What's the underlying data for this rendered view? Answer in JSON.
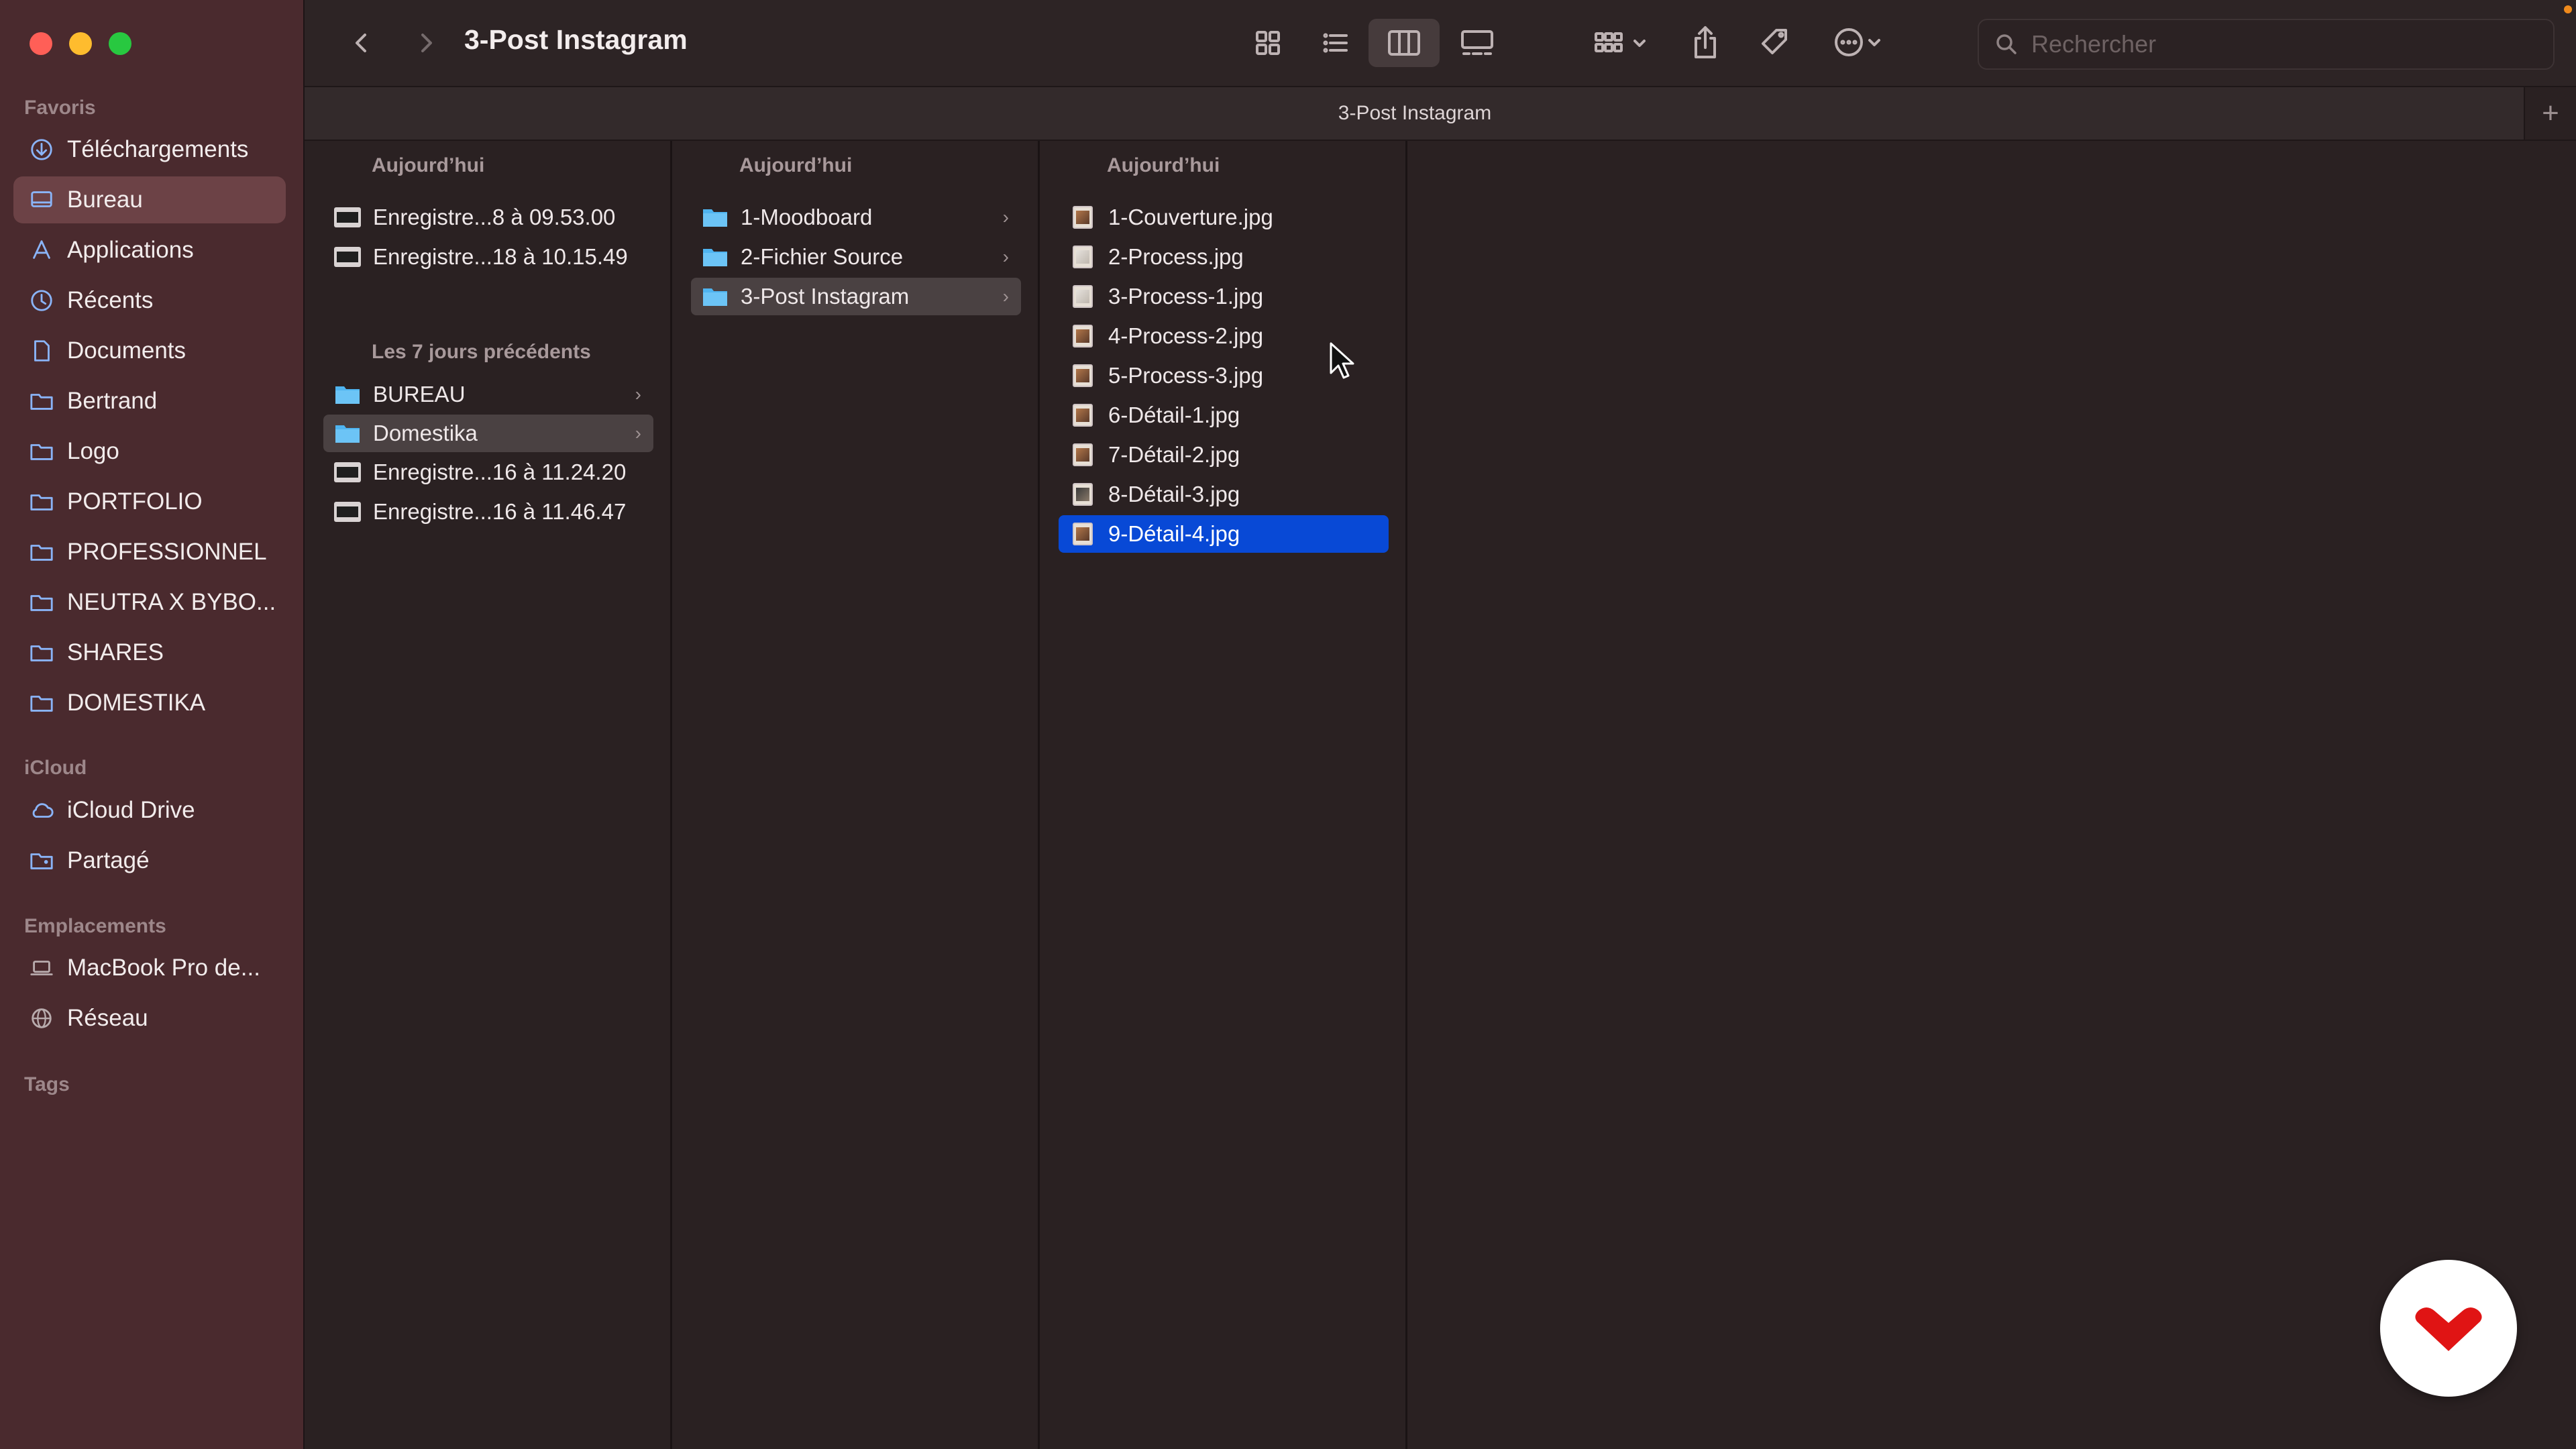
{
  "window": {
    "title": "3-Post Instagram"
  },
  "colors": {
    "accent_selection": "#0849d6",
    "sidebar_bg": "#4a2a2e",
    "folder_blue": "#4fb4f0"
  },
  "sidebar": {
    "favorites_title": "Favoris",
    "favorites": [
      {
        "label": "Téléchargements",
        "icon": "download-icon"
      },
      {
        "label": "Bureau",
        "icon": "desktop-icon",
        "selected": true
      },
      {
        "label": "Applications",
        "icon": "applications-icon"
      },
      {
        "label": "Récents",
        "icon": "clock-icon"
      },
      {
        "label": "Documents",
        "icon": "document-icon"
      },
      {
        "label": "Bertrand",
        "icon": "folder-icon"
      },
      {
        "label": "Logo",
        "icon": "folder-icon"
      },
      {
        "label": "PORTFOLIO",
        "icon": "folder-icon"
      },
      {
        "label": "PROFESSIONNEL",
        "icon": "folder-icon"
      },
      {
        "label": "NEUTRA X BYBO...",
        "icon": "folder-icon"
      },
      {
        "label": "SHARES",
        "icon": "folder-icon"
      },
      {
        "label": "DOMESTIKA",
        "icon": "folder-icon"
      }
    ],
    "icloud_title": "iCloud",
    "icloud": [
      {
        "label": "iCloud Drive",
        "icon": "cloud-icon"
      },
      {
        "label": "Partagé",
        "icon": "shared-folder-icon"
      }
    ],
    "locations_title": "Emplacements",
    "locations": [
      {
        "label": "MacBook Pro de...",
        "icon": "laptop-icon"
      },
      {
        "label": "Réseau",
        "icon": "network-icon"
      }
    ],
    "tags_title": "Tags"
  },
  "toolbar": {
    "search_placeholder": "Rechercher"
  },
  "tabbar": {
    "title": "3-Post Instagram",
    "add_label": "+"
  },
  "columns": [
    {
      "header": "Aujourd’hui",
      "items": [
        {
          "label": "Enregistre...8 à 09.53.00",
          "kind": "movie"
        },
        {
          "label": "Enregistre...18 à 10.15.49",
          "kind": "movie"
        }
      ],
      "group2_header": "Les 7 jours précédents",
      "group2_items": [
        {
          "label": "BUREAU",
          "kind": "folder",
          "chevron": "›"
        },
        {
          "label": "Domestika",
          "kind": "folder",
          "chevron": "›",
          "selected": "inactive"
        },
        {
          "label": "Enregistre...16 à 11.24.20",
          "kind": "movie"
        },
        {
          "label": "Enregistre...16 à 11.46.47",
          "kind": "movie"
        }
      ]
    },
    {
      "header": "Aujourd’hui",
      "items": [
        {
          "label": "1-Moodboard",
          "kind": "folder",
          "chevron": "›"
        },
        {
          "label": "2-Fichier Source",
          "kind": "folder",
          "chevron": "›"
        },
        {
          "label": "3-Post Instagram",
          "kind": "folder",
          "chevron": "›",
          "selected": "inactive"
        }
      ]
    },
    {
      "header": "Aujourd’hui",
      "items": [
        {
          "label": "1-Couverture.jpg",
          "kind": "image"
        },
        {
          "label": "2-Process.jpg",
          "kind": "image"
        },
        {
          "label": "3-Process-1.jpg",
          "kind": "image"
        },
        {
          "label": "4-Process-2.jpg",
          "kind": "image"
        },
        {
          "label": "5-Process-3.jpg",
          "kind": "image"
        },
        {
          "label": "6-Détail-1.jpg",
          "kind": "image"
        },
        {
          "label": "7-Détail-2.jpg",
          "kind": "image"
        },
        {
          "label": "8-Détail-3.jpg",
          "kind": "image"
        },
        {
          "label": "9-Détail-4.jpg",
          "kind": "image",
          "selected": "active"
        }
      ]
    }
  ]
}
